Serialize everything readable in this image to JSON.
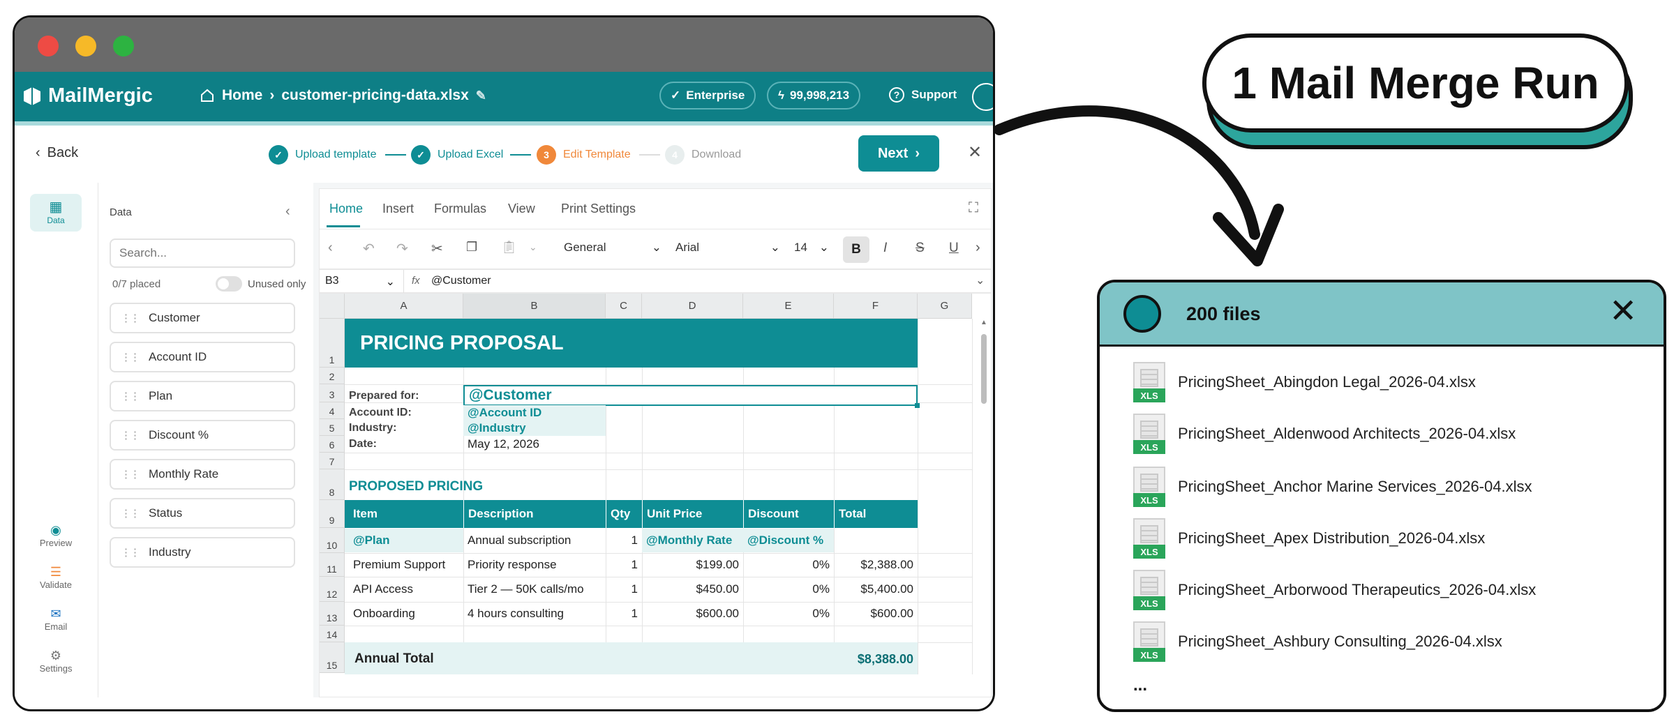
{
  "app": {
    "brand": "MailMergic",
    "breadcrumb_home": "Home",
    "breadcrumb_sep": "›",
    "file_name": "customer-pricing-data.xlsx",
    "plan_badge": "Enterprise",
    "credits": "99,998,213",
    "support": "Support"
  },
  "wizard": {
    "back": "Back",
    "steps": [
      {
        "label": "Upload template",
        "state": "done"
      },
      {
        "label": "Upload Excel",
        "state": "done"
      },
      {
        "label": "Edit Template",
        "state": "active",
        "number": "3"
      },
      {
        "label": "Download",
        "state": "pending",
        "number": "4"
      }
    ],
    "next": "Next"
  },
  "rail": {
    "items": [
      {
        "label": "Data",
        "icon": "grid-icon"
      },
      {
        "label": "Preview",
        "icon": "eye-icon"
      },
      {
        "label": "Validate",
        "icon": "checklist-icon"
      },
      {
        "label": "Email",
        "icon": "mail-icon"
      },
      {
        "label": "Settings",
        "icon": "gear-icon"
      }
    ]
  },
  "data_panel": {
    "title": "Data",
    "search_placeholder": "Search...",
    "placed": "0/7 placed",
    "unused_only": "Unused only",
    "fields": [
      "Customer",
      "Account ID",
      "Plan",
      "Discount %",
      "Monthly Rate",
      "Status",
      "Industry"
    ]
  },
  "ribbon": {
    "tabs": [
      "Home",
      "Insert",
      "Formulas",
      "View",
      "Print Settings"
    ],
    "number_format": "General",
    "font": "Arial",
    "font_size": "14"
  },
  "formula_bar": {
    "cell_ref": "B3",
    "fx": "fx",
    "value": "@Customer"
  },
  "sheet": {
    "columns": [
      "A",
      "B",
      "C",
      "D",
      "E",
      "F",
      "G"
    ],
    "rows": [
      "1",
      "2",
      "3",
      "4",
      "5",
      "6",
      "7",
      "8",
      "9",
      "10",
      "11",
      "12",
      "13",
      "14",
      "15"
    ],
    "title": "PRICING PROPOSAL",
    "prepared_for_label": "Prepared for:",
    "prepared_for_value": "@Customer",
    "account_label": "Account ID:",
    "account_value": "@Account ID",
    "industry_label": "Industry:",
    "industry_value": "@Industry",
    "date_label": "Date:",
    "date_value": "May 12, 2026",
    "section_title": "PROPOSED PRICING",
    "table_headers": [
      "Item",
      "Description",
      "Qty",
      "Unit Price",
      "Discount",
      "Total"
    ],
    "table_rows": [
      [
        "@Plan",
        "Annual subscription",
        "1",
        "@Monthly Rate",
        "@Discount %",
        ""
      ],
      [
        "Premium Support",
        "Priority response",
        "1",
        "$199.00",
        "0%",
        "$2,388.00"
      ],
      [
        "API Access",
        "Tier 2 — 50K calls/mo",
        "1",
        "$450.00",
        "0%",
        "$5,400.00"
      ],
      [
        "Onboarding",
        "4 hours consulting",
        "1",
        "$600.00",
        "0%",
        "$600.00"
      ]
    ],
    "annual_total_label": "Annual Total",
    "annual_total_value": "$8,388.00"
  },
  "banner": {
    "text": "1 Mail Merge Run"
  },
  "files": {
    "title": "200 files",
    "icon_tag": "XLS",
    "items": [
      "PricingSheet_Abingdon Legal_2026-04.xlsx",
      "PricingSheet_Aldenwood Architects_2026-04.xlsx",
      "PricingSheet_Anchor Marine Services_2026-04.xlsx",
      "PricingSheet_Apex Distribution_2026-04.xlsx",
      "PricingSheet_Arborwood Therapeutics_2026-04.xlsx",
      "PricingSheet_Ashbury Consulting_2026-04.xlsx"
    ],
    "more": "..."
  },
  "colors": {
    "brand_teal": "#0e7f86",
    "accent_teal": "#0e8d94",
    "active_step": "#f0883a",
    "file_header": "#7fc4c7",
    "xls_green": "#2aa55a"
  }
}
